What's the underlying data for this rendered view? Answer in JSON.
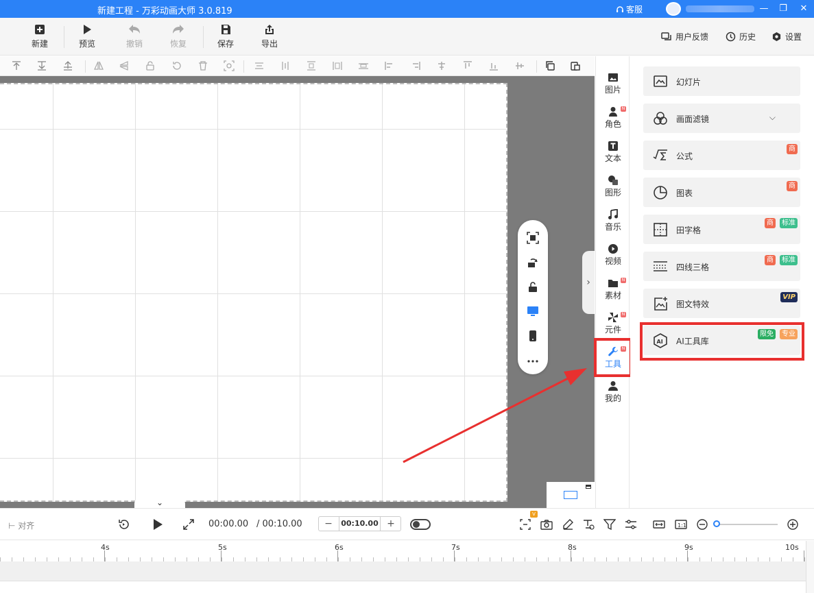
{
  "titlebar": {
    "title": "新建工程 - 万彩动画大师 3.0.819",
    "service_label": "客服",
    "minimize_glyph": "—",
    "restore_glyph": "❐",
    "close_glyph": "✕"
  },
  "toolbar": {
    "new_label": "新建",
    "preview_label": "预览",
    "undo_label": "撤销",
    "redo_label": "恢复",
    "save_label": "保存",
    "export_label": "导出",
    "feedback_label": "用户反馈",
    "history_label": "历史",
    "settings_label": "设置"
  },
  "canvas": {
    "collapse_glyph": "›",
    "bottom_tab_glyph": "⌄"
  },
  "sidenav": {
    "items": [
      {
        "label": "图片",
        "icon": "image-icon",
        "is_new": false
      },
      {
        "label": "角色",
        "icon": "person-icon",
        "is_new": true
      },
      {
        "label": "文本",
        "icon": "text-icon",
        "is_new": false
      },
      {
        "label": "图形",
        "icon": "shape-icon",
        "is_new": false
      },
      {
        "label": "音乐",
        "icon": "music-icon",
        "is_new": false
      },
      {
        "label": "视频",
        "icon": "video-icon",
        "is_new": false
      },
      {
        "label": "素材",
        "icon": "folder-icon",
        "is_new": true
      },
      {
        "label": "元件",
        "icon": "pinwheel-icon",
        "is_new": true
      },
      {
        "label": "工具",
        "icon": "wrench-icon",
        "is_new": true,
        "active": true
      },
      {
        "label": "我的",
        "icon": "user-icon",
        "is_new": false
      }
    ],
    "new_badge_text": "N",
    "active_color": "#2b82f7"
  },
  "tools_panel": {
    "items": [
      {
        "label": "幻灯片",
        "icon": "slideshow-icon",
        "badges": []
      },
      {
        "label": "画面滤镜",
        "icon": "filter-icon",
        "badges": [],
        "expandable": true,
        "chevron": "⌵"
      },
      {
        "label": "公式",
        "icon": "formula-icon",
        "badges": [
          "商"
        ]
      },
      {
        "label": "图表",
        "icon": "pie-chart-icon",
        "badges": [
          "商"
        ]
      },
      {
        "label": "田字格",
        "icon": "grid-icon",
        "badges": [
          "商",
          "标准"
        ]
      },
      {
        "label": "四线三格",
        "icon": "lines-icon",
        "badges": [
          "商",
          "标准"
        ]
      },
      {
        "label": "图文特效",
        "icon": "image-effect-icon",
        "badges": [
          "VIP"
        ]
      },
      {
        "label": "AI工具库",
        "icon": "ai-icon",
        "badges": [
          "限免",
          "专业"
        ],
        "highlighted": true
      }
    ]
  },
  "timeline": {
    "align_label": "对齐",
    "current_time": "00:00.00",
    "total_time": "/ 00:10.00",
    "duration_value": "00:10.00",
    "minus_glyph": "−",
    "plus_glyph": "+",
    "v_badge": "V",
    "ruler_labels": [
      "4s",
      "5s",
      "6s",
      "7s",
      "8s",
      "9s",
      "10s"
    ]
  },
  "colors": {
    "brand_blue": "#2b82f7",
    "highlight_red": "#e8302f"
  }
}
